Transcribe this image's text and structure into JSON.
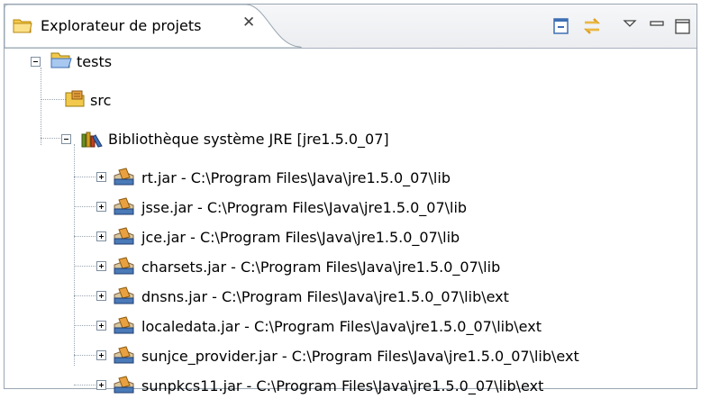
{
  "view": {
    "title": "Explorateur de projets",
    "close_glyph": "✕",
    "toolbar": [
      {
        "name": "collapse-all-icon"
      },
      {
        "name": "link-with-editor-icon"
      },
      {
        "name": "view-menu-icon"
      },
      {
        "name": "minimize-icon"
      },
      {
        "name": "maximize-icon"
      }
    ]
  },
  "tree": {
    "project": {
      "label": "tests",
      "expanded": true,
      "icon": "project-folder-icon"
    },
    "src": {
      "label": "src",
      "icon": "source-folder-icon"
    },
    "library": {
      "label": "Bibliothèque système JRE [jre1.5.0_07]",
      "expanded": true,
      "icon": "library-icon"
    },
    "jars": [
      {
        "label": "rt.jar - C:\\Program Files\\Java\\jre1.5.0_07\\lib"
      },
      {
        "label": "jsse.jar - C:\\Program Files\\Java\\jre1.5.0_07\\lib"
      },
      {
        "label": "jce.jar - C:\\Program Files\\Java\\jre1.5.0_07\\lib"
      },
      {
        "label": "charsets.jar - C:\\Program Files\\Java\\jre1.5.0_07\\lib"
      },
      {
        "label": "dnsns.jar - C:\\Program Files\\Java\\jre1.5.0_07\\lib\\ext"
      },
      {
        "label": "localedata.jar - C:\\Program Files\\Java\\jre1.5.0_07\\lib\\ext"
      },
      {
        "label": "sunjce_provider.jar - C:\\Program Files\\Java\\jre1.5.0_07\\lib\\ext"
      },
      {
        "label": "sunpkcs11.jar - C:\\Program Files\\Java\\jre1.5.0_07\\lib\\ext"
      }
    ]
  }
}
